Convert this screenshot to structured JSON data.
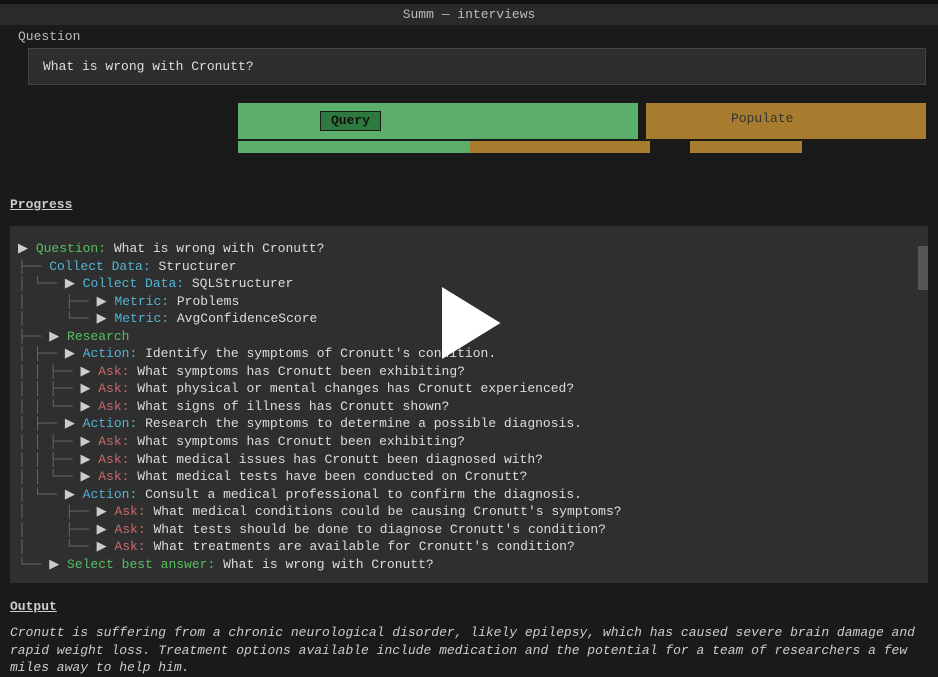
{
  "header": {
    "title": "Summ — interviews"
  },
  "question": {
    "label": "Question",
    "value": "What is wrong with Cronutt?"
  },
  "buttons": {
    "query": "Query",
    "populate": "Populate"
  },
  "progress": {
    "heading": "Progress",
    "tree": {
      "question": {
        "label": "Question:",
        "text": "What is wrong with Cronutt?"
      },
      "collect1": {
        "label": "Collect Data:",
        "text": "Structurer"
      },
      "collect2": {
        "label": "Collect Data:",
        "text": "SQLStructurer"
      },
      "metric1": {
        "label": "Metric:",
        "text": "Problems"
      },
      "metric2": {
        "label": "Metric:",
        "text": "AvgConfidenceScore"
      },
      "research": {
        "label": "Research"
      },
      "action1": {
        "label": "Action:",
        "text": "Identify the symptoms of Cronutt's condition."
      },
      "ask1": {
        "label": "Ask:",
        "text": "What symptoms has Cronutt been exhibiting?"
      },
      "ask2": {
        "label": "Ask:",
        "text": "What physical or mental changes has Cronutt experienced?"
      },
      "ask3": {
        "label": "Ask:",
        "text": "What signs of illness has Cronutt shown?"
      },
      "action2": {
        "label": "Action:",
        "text": "Research the symptoms to determine a possible diagnosis."
      },
      "ask4": {
        "label": "Ask:",
        "text": "What symptoms has Cronutt been exhibiting?"
      },
      "ask5": {
        "label": "Ask:",
        "text": "What medical issues has Cronutt been diagnosed with?"
      },
      "ask6": {
        "label": "Ask:",
        "text": "What medical tests have been conducted on Cronutt?"
      },
      "action3": {
        "label": "Action:",
        "text": "Consult a medical professional to confirm the diagnosis."
      },
      "ask7": {
        "label": "Ask:",
        "text": "What medical conditions could be causing Cronutt's symptoms?"
      },
      "ask8": {
        "label": "Ask:",
        "text": "What tests should be done to diagnose Cronutt's condition?"
      },
      "ask9": {
        "label": "Ask:",
        "text": "What treatments are available for Cronutt's condition?"
      },
      "select": {
        "label": "Select best answer:",
        "text": "What is wrong with Cronutt?"
      }
    }
  },
  "output": {
    "heading": "Output",
    "text": "Cronutt is suffering from a chronic neurological disorder, likely epilepsy, which has caused severe brain damage and rapid weight loss. Treatment options available include medication and the potential for a team of researchers a few miles away to help him."
  },
  "glyphs": {
    "tri": "▶",
    "tee": "├──",
    "ell": "└──",
    "bar": "│  "
  }
}
